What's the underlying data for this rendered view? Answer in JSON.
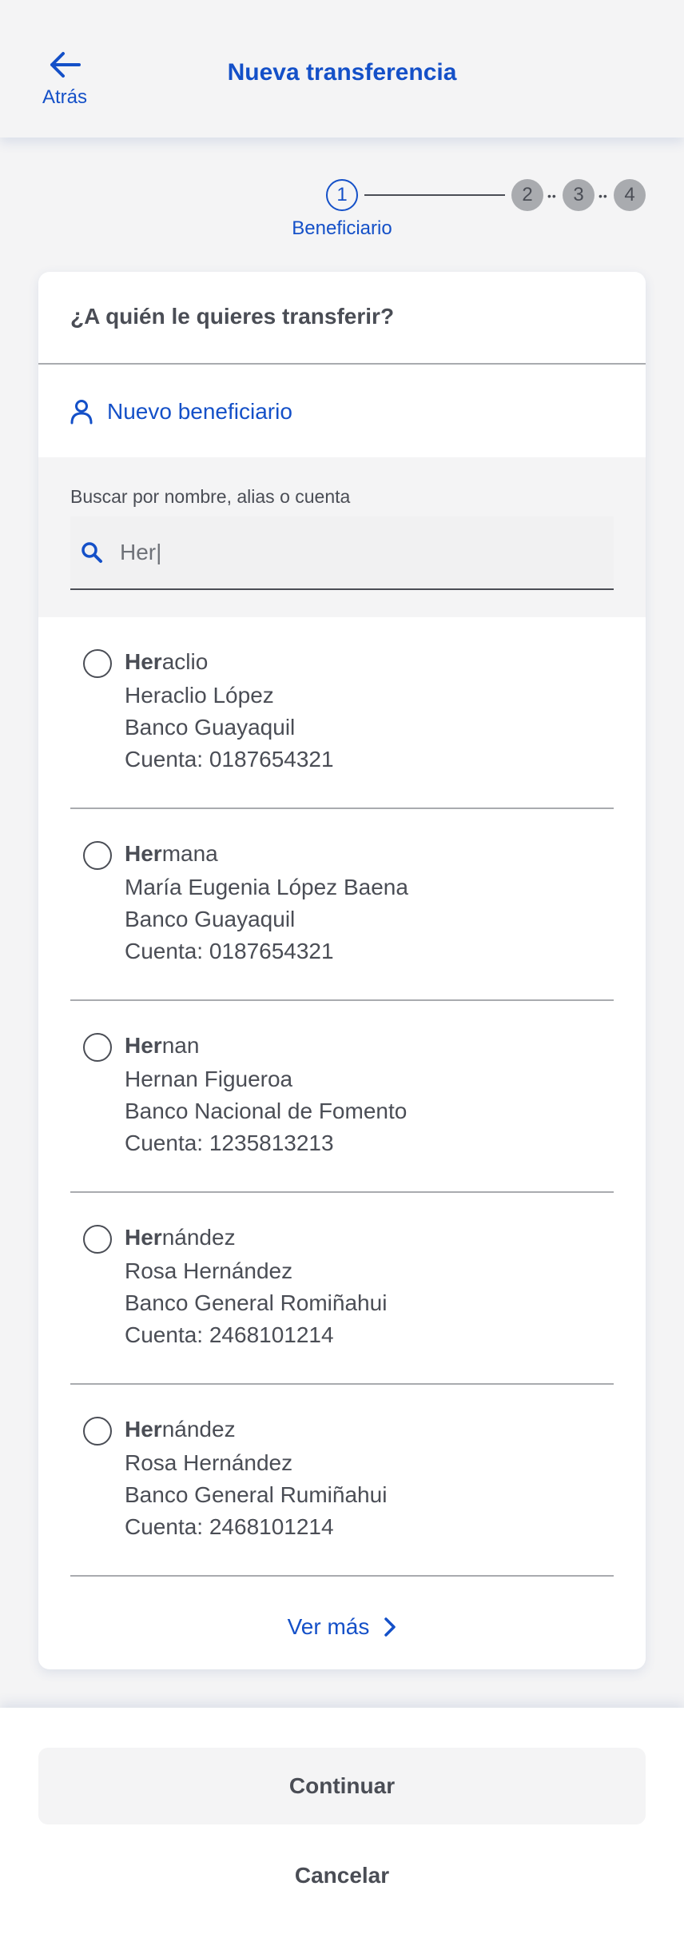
{
  "header": {
    "back_label": "Atrás",
    "title": "Nueva transferencia"
  },
  "stepper": {
    "steps": [
      "1",
      "2",
      "3",
      "4"
    ],
    "current_step": 1,
    "active_label": "Beneficiario"
  },
  "card": {
    "question": "¿A quién le quieres transferir?",
    "new_beneficiary_label": "Nuevo beneficiario",
    "search": {
      "label": "Buscar por nombre, alias o cuenta",
      "value": "Her|"
    },
    "results": [
      {
        "alias_match": "Her",
        "alias_rest": "aclio",
        "name": "Heraclio López",
        "bank": "Banco Guayaquil",
        "account": "Cuenta: 0187654321"
      },
      {
        "alias_match": "Her",
        "alias_rest": "mana",
        "name": "María Eugenia López Baena",
        "bank": "Banco Guayaquil",
        "account": "Cuenta: 0187654321"
      },
      {
        "alias_match": "Her",
        "alias_rest": "nan",
        "name": "Hernan Figueroa",
        "bank": "Banco Nacional de Fomento",
        "account": "Cuenta: 1235813213"
      },
      {
        "alias_match": "Her",
        "alias_rest": "nández",
        "name": "Rosa Hernández",
        "bank": "Banco General Romiñahui",
        "account": "Cuenta: 2468101214"
      },
      {
        "alias_match": "Her",
        "alias_rest": "nández",
        "name": "Rosa Hernández",
        "bank": "Banco General Rumiñahui",
        "account": "Cuenta: 2468101214"
      }
    ],
    "see_more_label": "Ver más"
  },
  "footer": {
    "continue_label": "Continuar",
    "cancel_label": "Cancelar"
  },
  "colors": {
    "accent": "#1450c8",
    "text": "#4a4d55",
    "background": "#f4f4f5",
    "inactive_step": "#a9abaf"
  }
}
